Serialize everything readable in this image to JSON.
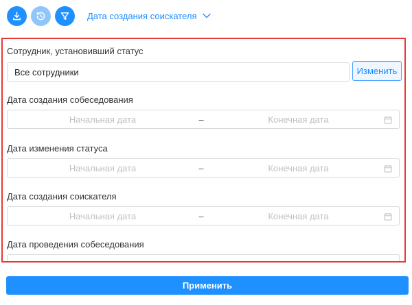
{
  "toolbar": {
    "buttons": [
      {
        "name": "download-icon",
        "enabled": true
      },
      {
        "name": "history-icon",
        "enabled": false
      },
      {
        "name": "filter-icon",
        "enabled": true
      }
    ],
    "sort_label": "Дата создания соискателя"
  },
  "filters": {
    "employee_label": "Сотрудник, установивший статус",
    "employee_value": "Все сотрудники",
    "change_button": "Изменить",
    "ranges": [
      {
        "label": "Дата создания собеседования",
        "start_placeholder": "Начальная дата",
        "separator": "–",
        "end_placeholder": "Конечная дата"
      },
      {
        "label": "Дата изменения статуса",
        "start_placeholder": "Начальная дата",
        "separator": "–",
        "end_placeholder": "Конечная дата"
      },
      {
        "label": "Дата создания соискателя",
        "start_placeholder": "Начальная дата",
        "separator": "–",
        "end_placeholder": "Конечная дата"
      },
      {
        "label": "Дата проведения собеседования"
      }
    ]
  },
  "apply_button": "Применить",
  "colors": {
    "accent": "#1e90ff",
    "accent_disabled": "#8ec6fb",
    "highlight_border": "#e53935"
  }
}
